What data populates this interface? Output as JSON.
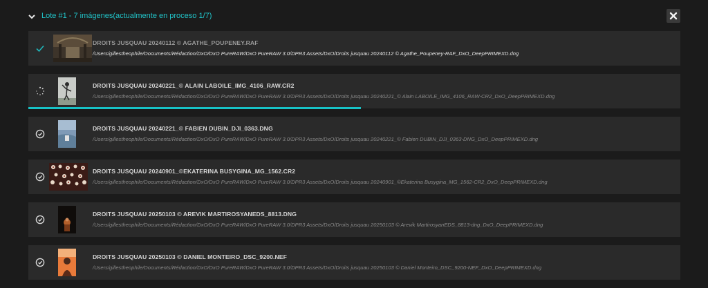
{
  "batch": {
    "title": "Lote #1 - 7 imágenes(actualmente en proceso 1/7)",
    "accent": "#21c4c9"
  },
  "items": [
    {
      "title": "DROITS JUSQUAU 20240112 © AGATHE_POUPENEY.RAF",
      "path": "/Users/gillestheophile/Documents/Rédaction/DxO/DxO PureRAW/DxO PureRAW 3.0/DPR3 Assets/DxO/Droits jusquau 20240112 © Agathe_Poupeney-RAF_DxO_DeepPRIMEXD.dng",
      "status": "done",
      "status_icon": "checkmark-icon"
    },
    {
      "title": "DROITS JUSQUAU 20240221_© ALAIN LABOILE_IMG_4106_RAW.CR2",
      "path": "/Users/gillestheophile/Documents/Rédaction/DxO/DxO PureRAW/DxO PureRAW 3.0/DPR3 Assets/DxO/Droits jusquau 20240221_© Alain LABOILE_IMG_4106_RAW-CR2_DxO_DeepPRIMEXD.dng",
      "status": "processing",
      "status_icon": "spinner-icon",
      "progress": 0.51
    },
    {
      "title": "DROITS JUSQUAU 20240221_© FABIEN DUBIN_DJI_0363.DNG",
      "path": "/Users/gillestheophile/Documents/Rédaction/DxO/DxO PureRAW/DxO PureRAW 3.0/DPR3 Assets/DxO/Droits jusquau 20240221_© Fabien DUBIN_DJI_0363-DNG_DxO_DeepPRIMEXD.dng",
      "status": "queued",
      "status_icon": "clock-icon"
    },
    {
      "title": "DROITS JUSQUAU 20240901_©EKATERINA BUSYGINA_MG_1562.CR2",
      "path": "/Users/gillestheophile/Documents/Rédaction/DxO/DxO PureRAW/DxO PureRAW 3.0/DPR3 Assets/DxO/Droits jusquau 20240901_©Ekaterina Busygina_MG_1562-CR2_DxO_DeepPRIMEXD.dng",
      "status": "queued",
      "status_icon": "clock-icon"
    },
    {
      "title": "DROITS JUSQUAU 20250103 © AREVIK MARTIROSYANEDS_8813.DNG",
      "path": "/Users/gillestheophile/Documents/Rédaction/DxO/DxO PureRAW/DxO PureRAW 3.0/DPR3 Assets/DxO/Droits jusquau 20250103 © Arevik MartirosyanEDS_8813-dng_DxO_DeepPRIMEXD.dng",
      "status": "queued",
      "status_icon": "clock-icon"
    },
    {
      "title": "DROITS JUSQUAU 20250103 © DANIEL MONTEIRO_DSC_9200.NEF",
      "path": "/Users/gillestheophile/Documents/Rédaction/DxO/DxO PureRAW/DxO PureRAW 3.0/DPR3 Assets/DxO/Droits jusquau 20250103 © Daniel Monteiro_DSC_9200-NEF_DxO_DeepPRIMEXD.dng",
      "status": "queued",
      "status_icon": "clock-icon"
    }
  ]
}
